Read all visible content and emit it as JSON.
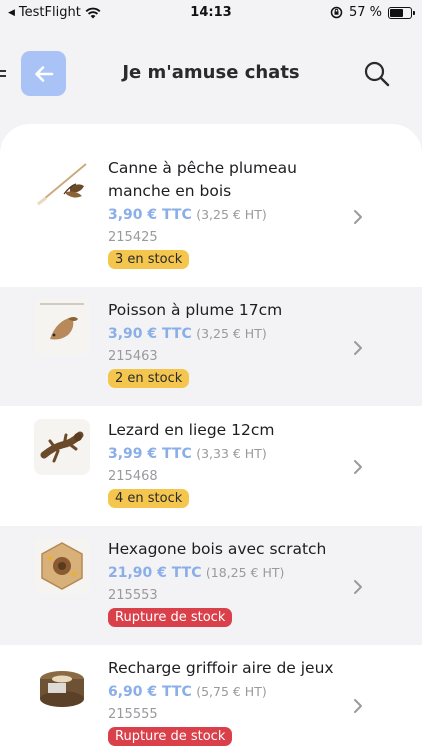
{
  "status_bar": {
    "carrier": "TestFlight",
    "time": "14:13",
    "battery_text": "57 %"
  },
  "header": {
    "title": "Je m'amuse chats"
  },
  "colors": {
    "accent": "#8aaee8",
    "back_button": "#a9c3f7",
    "in_stock": "#f4c64d",
    "out_of_stock": "#d9404a"
  },
  "products": [
    {
      "name": "Canne à pêche plumeau manche en bois",
      "price_ttc": "3,90 € TTC",
      "price_ht": "(3,25 € HT)",
      "ref": "215425",
      "stock": "3 en stock",
      "icon": "feather-wand-icon"
    },
    {
      "name": "Poisson à plume 17cm",
      "price_ttc": "3,90 € TTC",
      "price_ht": "(3,25 € HT)",
      "ref": "215463",
      "stock": "2 en stock",
      "icon": "fish-toy-icon"
    },
    {
      "name": "Lezard en liege 12cm",
      "price_ttc": "3,99 € TTC",
      "price_ht": "(3,33 € HT)",
      "ref": "215468",
      "stock": "4 en stock",
      "icon": "lizard-toy-icon"
    },
    {
      "name": "Hexagone bois avec scratch",
      "price_ttc": "21,90 € TTC",
      "price_ht": "(18,25 € HT)",
      "ref": "215553",
      "stock": "Rupture de stock",
      "icon": "hexagon-toy-icon"
    },
    {
      "name": "Recharge griffoir aire de jeux",
      "price_ttc": "6,90 € TTC",
      "price_ht": "(5,75 € HT)",
      "ref": "215555",
      "stock": "Rupture de stock",
      "icon": "scratcher-roll-icon"
    }
  ]
}
